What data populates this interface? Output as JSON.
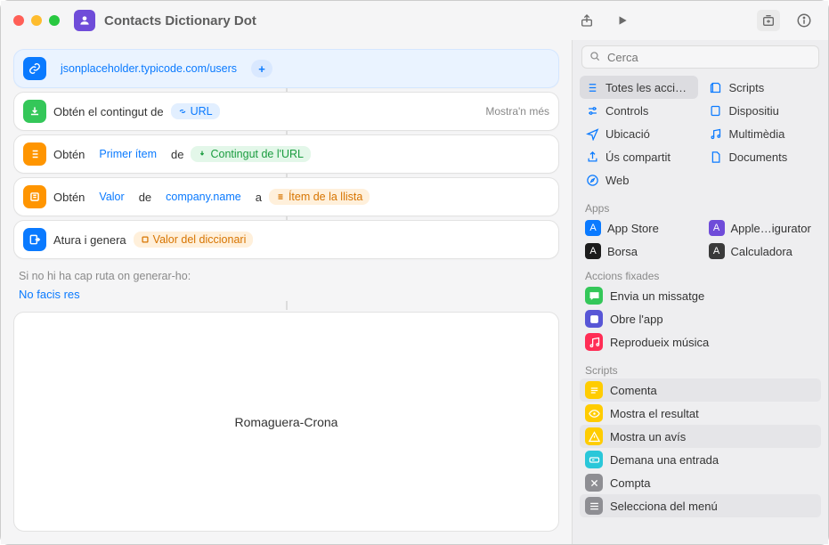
{
  "title": "Contacts Dictionary Dot",
  "url_block": {
    "url": "jsonplaceholder.typicode.com/users"
  },
  "get_content": {
    "label": "Obtén el contingut de",
    "param": "URL",
    "more": "Mostra'n més"
  },
  "get_first": {
    "label1": "Obtén",
    "token_first": "Primer ítem",
    "label2": "de",
    "token_src": "Contingut de l'URL"
  },
  "get_value": {
    "label1": "Obtén",
    "token_val": "Valor",
    "label2": "de",
    "token_path": "company.name",
    "label3": "a",
    "token_item": "Ítem de la llista"
  },
  "output": {
    "label": "Atura i genera",
    "token": "Valor del diccionari"
  },
  "noroute": {
    "text": "Si no hi ha cap ruta on generar-ho:",
    "action": "No facis res"
  },
  "result": "Romaguera-Crona",
  "search_placeholder": "Cerca",
  "categories": [
    {
      "label": "Totes les acci…",
      "color": "#0a7aff",
      "sel": true,
      "icon": "list"
    },
    {
      "label": "Scripts",
      "color": "#0a7aff",
      "icon": "script"
    },
    {
      "label": "Controls",
      "color": "#0a7aff",
      "icon": "sliders"
    },
    {
      "label": "Dispositiu",
      "color": "#0a7aff",
      "icon": "device"
    },
    {
      "label": "Ubicació",
      "color": "#0a7aff",
      "icon": "nav"
    },
    {
      "label": "Multimèdia",
      "color": "#0a7aff",
      "icon": "music"
    },
    {
      "label": "Ús compartit",
      "color": "#0a7aff",
      "icon": "share"
    },
    {
      "label": "Documents",
      "color": "#0a7aff",
      "icon": "doc"
    },
    {
      "label": "Web",
      "color": "#0a7aff",
      "icon": "safari"
    }
  ],
  "apps_head": "Apps",
  "apps": [
    {
      "label": "App Store",
      "bg": "#0a7aff"
    },
    {
      "label": "Apple…igurator",
      "bg": "#6f4cd9"
    },
    {
      "label": "Borsa",
      "bg": "#1c1c1c"
    },
    {
      "label": "Calculadora",
      "bg": "#3a3a3a"
    }
  ],
  "pinned_head": "Accions fixades",
  "pinned": [
    {
      "label": "Envia un missatge",
      "bg": "#34c759",
      "icon": "msg"
    },
    {
      "label": "Obre l'app",
      "bg": "#5856d6",
      "icon": "open"
    },
    {
      "label": "Reprodueix música",
      "bg": "#ff2d55",
      "icon": "music"
    }
  ],
  "scripts_head": "Scripts",
  "scripts": [
    {
      "label": "Comenta",
      "bg": "#ffcc00",
      "icon": "lines",
      "hl": true
    },
    {
      "label": "Mostra el resultat",
      "bg": "#ffcc00",
      "icon": "eye"
    },
    {
      "label": "Mostra un avís",
      "bg": "#ffcc00",
      "icon": "alert",
      "hl": true
    },
    {
      "label": "Demana una entrada",
      "bg": "#2ac7d9",
      "icon": "input"
    },
    {
      "label": "Compta",
      "bg": "#8e8e93",
      "icon": "x"
    },
    {
      "label": "Selecciona del menú",
      "bg": "#8e8e93",
      "icon": "menu",
      "hl": true
    }
  ]
}
